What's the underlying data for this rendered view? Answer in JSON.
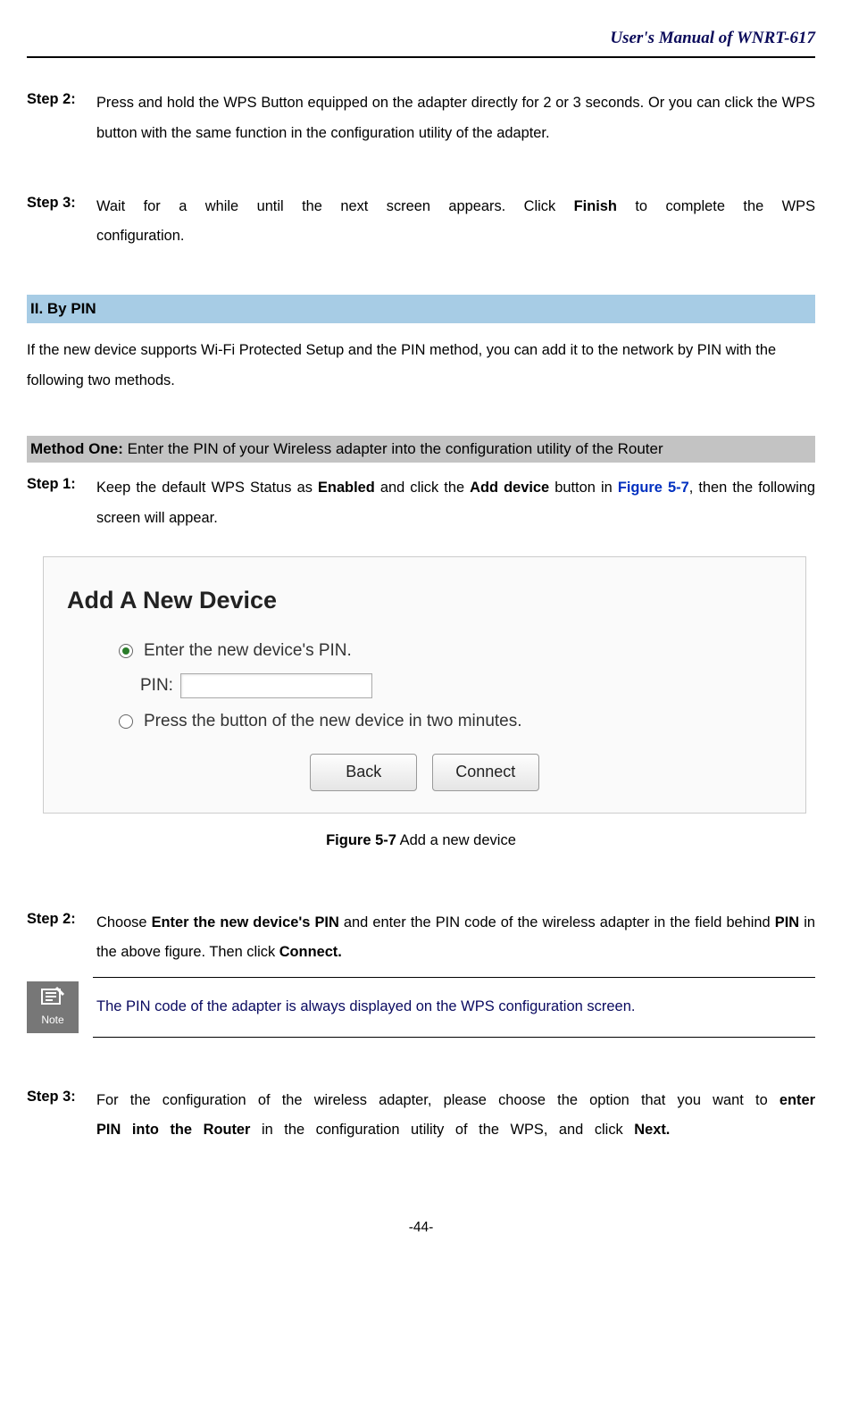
{
  "header": {
    "title": "User's Manual of WNRT-617"
  },
  "steps_a": [
    {
      "label": "Step 2:",
      "text": "Press and hold the WPS Button equipped on the adapter directly for 2 or 3 seconds. Or you can click the WPS button with the same function in the configuration utility of the adapter."
    },
    {
      "label": "Step 3:",
      "text_pre": "Wait for a while until the next screen appears. Click ",
      "bold": "Finish",
      "text_post": " to complete the WPS configuration."
    }
  ],
  "section2": {
    "heading": "II.    By PIN",
    "intro": "If the new device supports Wi-Fi Protected Setup and the PIN method, you can add it to the network by PIN with the following two methods."
  },
  "method1": {
    "heading_bold": "Method One:",
    "heading_rest": " Enter the PIN of your Wireless adapter into the configuration utility of the Router",
    "step1": {
      "label": "Step 1:",
      "pre": "Keep the default WPS Status as ",
      "b1": "Enabled",
      "mid": " and click the ",
      "b2": "Add device",
      "mid2": " button in ",
      "link": "Figure 5-7",
      "post": ", then the following screen will appear."
    }
  },
  "figure": {
    "title": "Add A New Device",
    "opt1": "Enter the new device's PIN.",
    "pin_label": "PIN:",
    "opt2": "Press the button of the new device in two minutes.",
    "btn_back": "Back",
    "btn_connect": "Connect",
    "caption_bold": "Figure 5-7",
    "caption_rest": "    Add a new device"
  },
  "steps_b": {
    "step2": {
      "label": "Step 2:",
      "pre": "Choose ",
      "b1": "Enter the new device's PIN",
      "mid": " and enter the PIN code of the wireless adapter in the field behind ",
      "b2": "PIN",
      "mid2": " in the above figure. Then click ",
      "b3": "Connect."
    },
    "note": {
      "badge": "Note",
      "text": "The PIN code of the adapter is always displayed on the WPS configuration screen."
    },
    "step3": {
      "label": "Step 3:",
      "pre": "For the configuration of the wireless adapter, please choose the option that you want to ",
      "b1": "enter PIN into the Router",
      "mid": " in the configuration utility of the WPS, and click ",
      "b2": "Next."
    }
  },
  "page_num": "-44-"
}
